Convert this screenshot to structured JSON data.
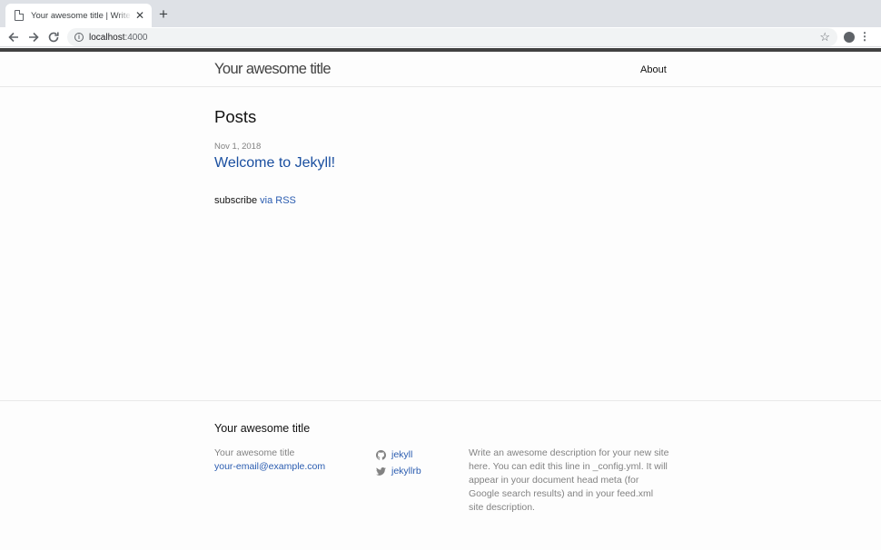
{
  "browser": {
    "tab_title": "Your awesome title | Write an awesome description for your new site here.",
    "close_glyph": "✕",
    "newtab_glyph": "+",
    "url_host": "localhost",
    "url_port": ":4000"
  },
  "header": {
    "site_title": "Your awesome title",
    "nav_about": "About"
  },
  "content": {
    "heading": "Posts",
    "posts": [
      {
        "date": "Nov 1, 2018",
        "title": "Welcome to Jekyll!"
      }
    ],
    "rss_prefix": "subscribe",
    "rss_link": "via RSS"
  },
  "footer": {
    "heading": "Your awesome title",
    "name": "Your awesome title",
    "email": "your-email@example.com",
    "social": [
      {
        "icon": "github-icon",
        "label": "jekyll"
      },
      {
        "icon": "twitter-icon",
        "label": "jekyllrb"
      }
    ],
    "description": "Write an awesome description for your new site here. You can edit this line in _config.yml. It will appear in your document head meta (for Google search results) and in your feed.xml site description."
  },
  "colors": {
    "accent": "#2a7ae2",
    "header_border": "#424242",
    "muted": "#828282"
  }
}
